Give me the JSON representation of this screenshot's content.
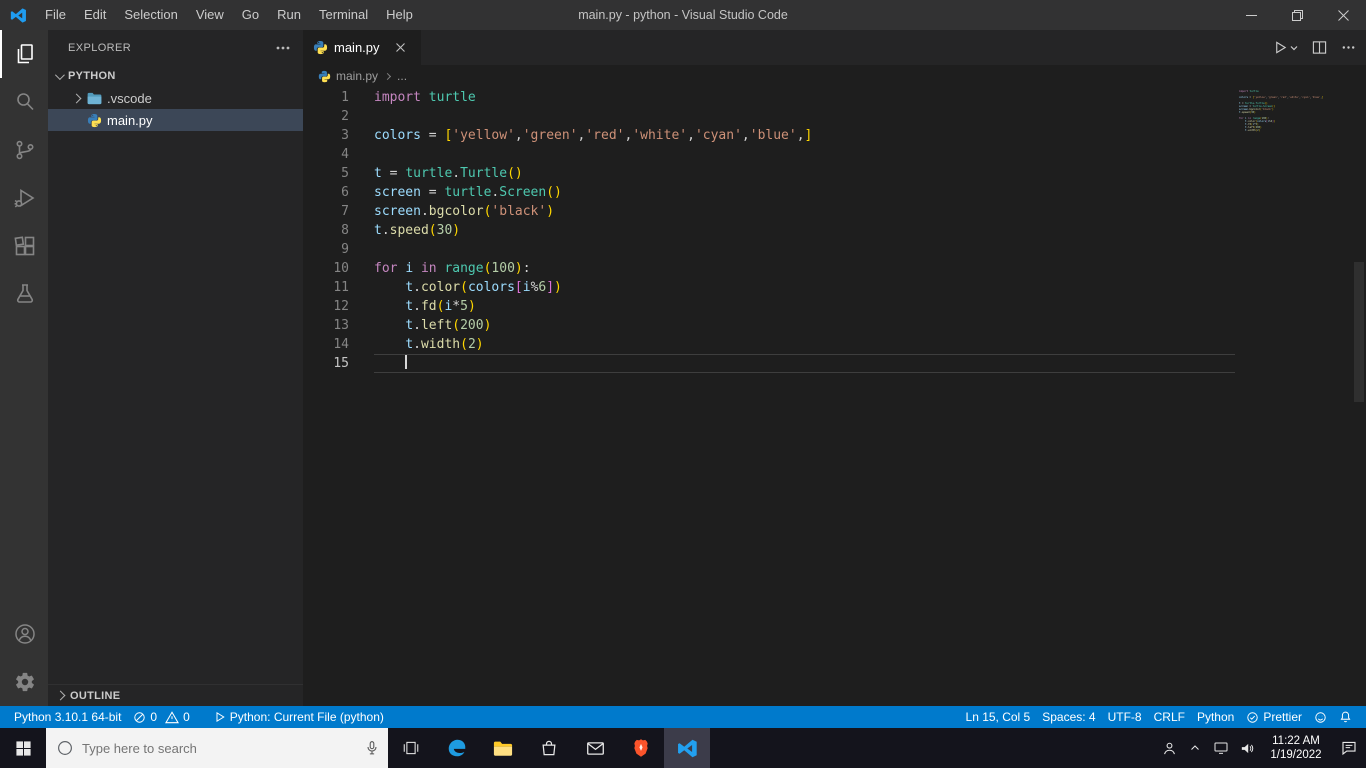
{
  "window": {
    "title": "main.py - python - Visual Studio Code",
    "menus": [
      "File",
      "Edit",
      "Selection",
      "View",
      "Go",
      "Run",
      "Terminal",
      "Help"
    ]
  },
  "sidebar": {
    "header": "EXPLORER",
    "section_label": "PYTHON",
    "items": [
      {
        "label": ".vscode",
        "type": "folder"
      },
      {
        "label": "main.py",
        "type": "python-file",
        "selected": true
      }
    ],
    "outline_label": "OUTLINE"
  },
  "editor": {
    "tab_label": "main.py",
    "breadcrumb_file": "main.py",
    "breadcrumb_symbol": "...",
    "cursor": {
      "line": 15,
      "col": 5
    },
    "token_colors": {
      "kw": "#C586C0",
      "mod": "#4EC9B0",
      "var": "#9CDCFE",
      "fn": "#DCDCAA",
      "str": "#CE9178",
      "num": "#B5CEA8",
      "def": "#D4D4D4",
      "br1": "#FFD700",
      "br2": "#DA70D6"
    },
    "lines": [
      {
        "tokens": [
          [
            "import",
            "kw"
          ],
          [
            " ",
            "def"
          ],
          [
            "turtle",
            "mod"
          ]
        ]
      },
      {
        "tokens": []
      },
      {
        "tokens": [
          [
            "colors",
            "var"
          ],
          [
            " = ",
            "def"
          ],
          [
            "[",
            "br1"
          ],
          [
            "'yellow'",
            "str"
          ],
          [
            ",",
            "def"
          ],
          [
            "'green'",
            "str"
          ],
          [
            ",",
            "def"
          ],
          [
            "'red'",
            "str"
          ],
          [
            ",",
            "def"
          ],
          [
            "'white'",
            "str"
          ],
          [
            ",",
            "def"
          ],
          [
            "'cyan'",
            "str"
          ],
          [
            ",",
            "def"
          ],
          [
            "'blue'",
            "str"
          ],
          [
            ",",
            "def"
          ],
          [
            "]",
            "br1"
          ]
        ]
      },
      {
        "tokens": []
      },
      {
        "tokens": [
          [
            "t",
            "var"
          ],
          [
            " = ",
            "def"
          ],
          [
            "turtle",
            "mod"
          ],
          [
            ".",
            "def"
          ],
          [
            "Turtle",
            "mod"
          ],
          [
            "(",
            "br1"
          ],
          [
            ")",
            "br1"
          ]
        ]
      },
      {
        "tokens": [
          [
            "screen",
            "var"
          ],
          [
            " = ",
            "def"
          ],
          [
            "turtle",
            "mod"
          ],
          [
            ".",
            "def"
          ],
          [
            "Screen",
            "mod"
          ],
          [
            "(",
            "br1"
          ],
          [
            ")",
            "br1"
          ]
        ]
      },
      {
        "tokens": [
          [
            "screen",
            "var"
          ],
          [
            ".",
            "def"
          ],
          [
            "bgcolor",
            "fn"
          ],
          [
            "(",
            "br1"
          ],
          [
            "'black'",
            "str"
          ],
          [
            ")",
            "br1"
          ]
        ]
      },
      {
        "tokens": [
          [
            "t",
            "var"
          ],
          [
            ".",
            "def"
          ],
          [
            "speed",
            "fn"
          ],
          [
            "(",
            "br1"
          ],
          [
            "30",
            "num"
          ],
          [
            ")",
            "br1"
          ]
        ]
      },
      {
        "tokens": []
      },
      {
        "tokens": [
          [
            "for",
            "kw"
          ],
          [
            " ",
            "def"
          ],
          [
            "i",
            "var"
          ],
          [
            " ",
            "def"
          ],
          [
            "in",
            "kw"
          ],
          [
            " ",
            "def"
          ],
          [
            "range",
            "mod"
          ],
          [
            "(",
            "br1"
          ],
          [
            "100",
            "num"
          ],
          [
            ")",
            "br1"
          ],
          [
            ":",
            "def"
          ]
        ]
      },
      {
        "tokens": [
          [
            "    ",
            "def"
          ],
          [
            "t",
            "var"
          ],
          [
            ".",
            "def"
          ],
          [
            "color",
            "fn"
          ],
          [
            "(",
            "br1"
          ],
          [
            "colors",
            "var"
          ],
          [
            "[",
            "br2"
          ],
          [
            "i",
            "var"
          ],
          [
            "%",
            "def"
          ],
          [
            "6",
            "num"
          ],
          [
            "]",
            "br2"
          ],
          [
            ")",
            "br1"
          ]
        ]
      },
      {
        "tokens": [
          [
            "    ",
            "def"
          ],
          [
            "t",
            "var"
          ],
          [
            ".",
            "def"
          ],
          [
            "fd",
            "fn"
          ],
          [
            "(",
            "br1"
          ],
          [
            "i",
            "var"
          ],
          [
            "*",
            "def"
          ],
          [
            "5",
            "num"
          ],
          [
            ")",
            "br1"
          ]
        ]
      },
      {
        "tokens": [
          [
            "    ",
            "def"
          ],
          [
            "t",
            "var"
          ],
          [
            ".",
            "def"
          ],
          [
            "left",
            "fn"
          ],
          [
            "(",
            "br1"
          ],
          [
            "200",
            "num"
          ],
          [
            ")",
            "br1"
          ]
        ]
      },
      {
        "tokens": [
          [
            "    ",
            "def"
          ],
          [
            "t",
            "var"
          ],
          [
            ".",
            "def"
          ],
          [
            "width",
            "fn"
          ],
          [
            "(",
            "br1"
          ],
          [
            "2",
            "num"
          ],
          [
            ")",
            "br1"
          ]
        ]
      },
      {
        "tokens": [
          [
            "    ",
            "def"
          ]
        ]
      }
    ]
  },
  "status_bar": {
    "background": "#007acc",
    "python_version": "Python 3.10.1 64-bit",
    "errors": "0",
    "warnings": "0",
    "run_context": "Python: Current File (python)",
    "cursor_position": "Ln 15, Col 5",
    "indentation": "Spaces: 4",
    "encoding": "UTF-8",
    "eol": "CRLF",
    "language": "Python",
    "formatter": "Prettier"
  },
  "taskbar": {
    "search_placeholder": "Type here to search",
    "time": "11:22 AM",
    "date": "1/19/2022"
  }
}
